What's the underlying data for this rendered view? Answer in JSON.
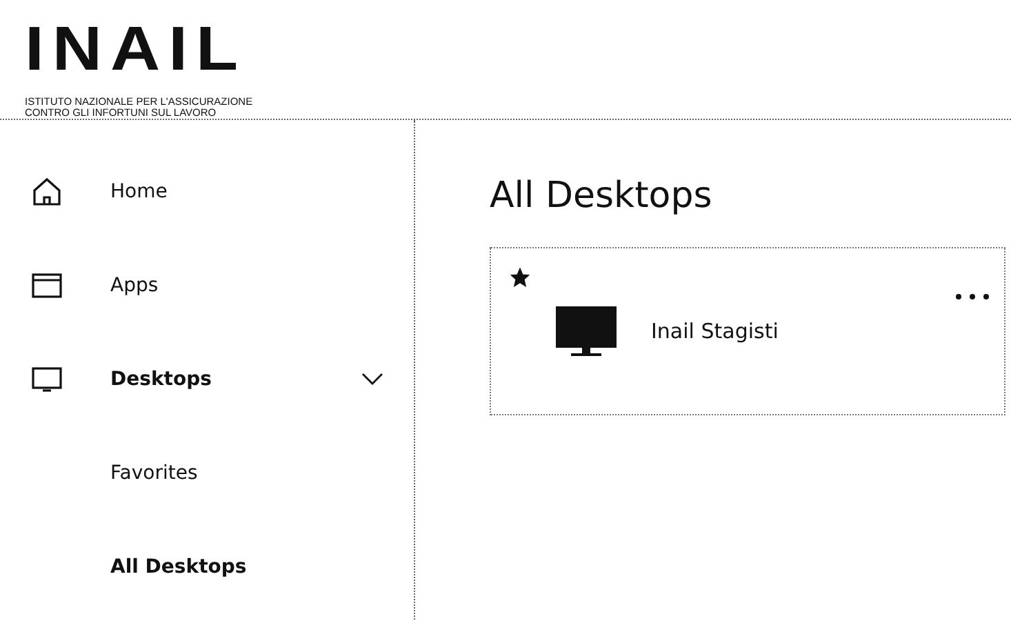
{
  "logo": {
    "wordmark": "INAIL",
    "subtitle_lines": [
      "ISTITUTO NAZIONALE PER L'ASSICURAZIONE",
      "CONTRO GLI INFORTUNI SUL LAVORO"
    ]
  },
  "sidebar": {
    "items": [
      {
        "label": "Home",
        "kind": "home",
        "selected": false
      },
      {
        "label": "Apps",
        "kind": "apps",
        "selected": false
      },
      {
        "label": "Desktops",
        "kind": "desktop",
        "selected": false,
        "expanded": true,
        "children": [
          {
            "label": "Favorites",
            "selected": false
          },
          {
            "label": "All Desktops",
            "selected": true
          }
        ]
      }
    ]
  },
  "main": {
    "title": "All Desktops",
    "desktops": [
      {
        "name": "Inail Stagisti",
        "favorite": true
      }
    ]
  }
}
